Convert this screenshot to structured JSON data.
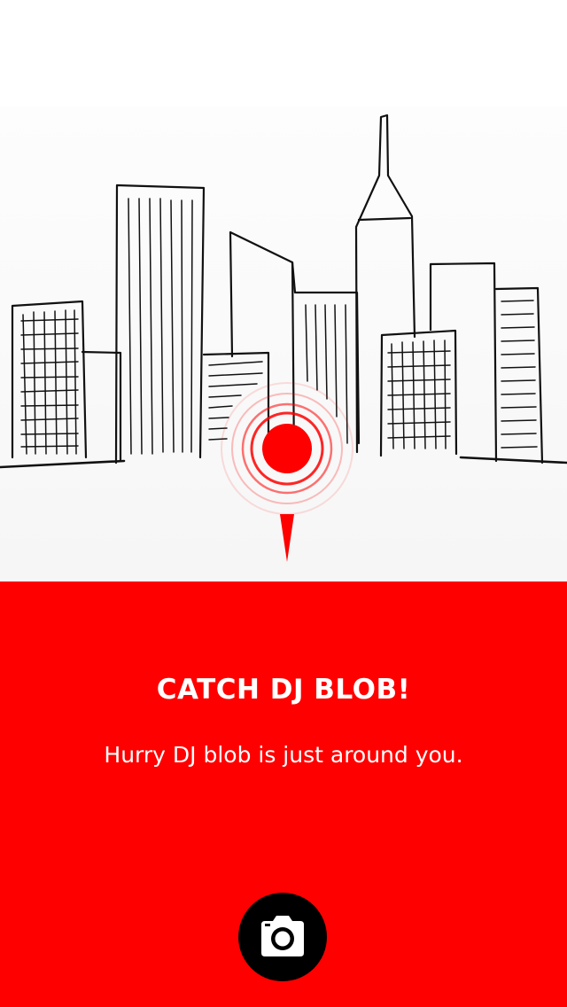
{
  "screen": {
    "title": "CATCH DJ BLOB!",
    "message": "Hurry DJ blob is just around you."
  },
  "colors": {
    "accent": "#ff0000",
    "button": "#000000",
    "text": "#ffffff"
  },
  "icons": {
    "location_pin": "map-pin-icon",
    "camera": "camera-icon"
  }
}
